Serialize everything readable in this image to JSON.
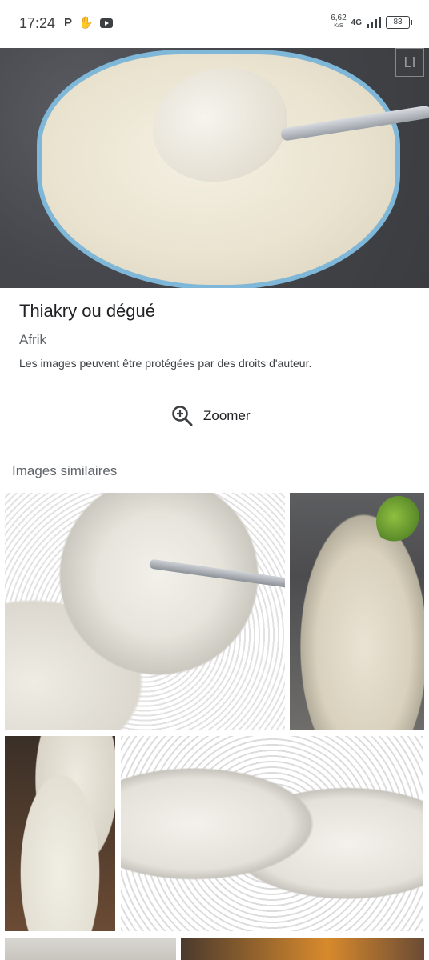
{
  "status_bar": {
    "time": "17:24",
    "left_icons": [
      "parking-icon",
      "notification-icon",
      "youtube-icon"
    ],
    "speed_value": "6,62",
    "speed_unit": "K/S",
    "network": "4G",
    "battery": "83"
  },
  "result": {
    "title": "Thiakry ou dégué",
    "source": "Afrik",
    "copyright_notice": "Les images peuvent être protégées par des droits d'auteur.",
    "zoom_label": "Zoomer"
  },
  "similar": {
    "heading": "Images similaires"
  },
  "colors": {
    "text_primary": "#202124",
    "text_secondary": "#5f6368"
  }
}
